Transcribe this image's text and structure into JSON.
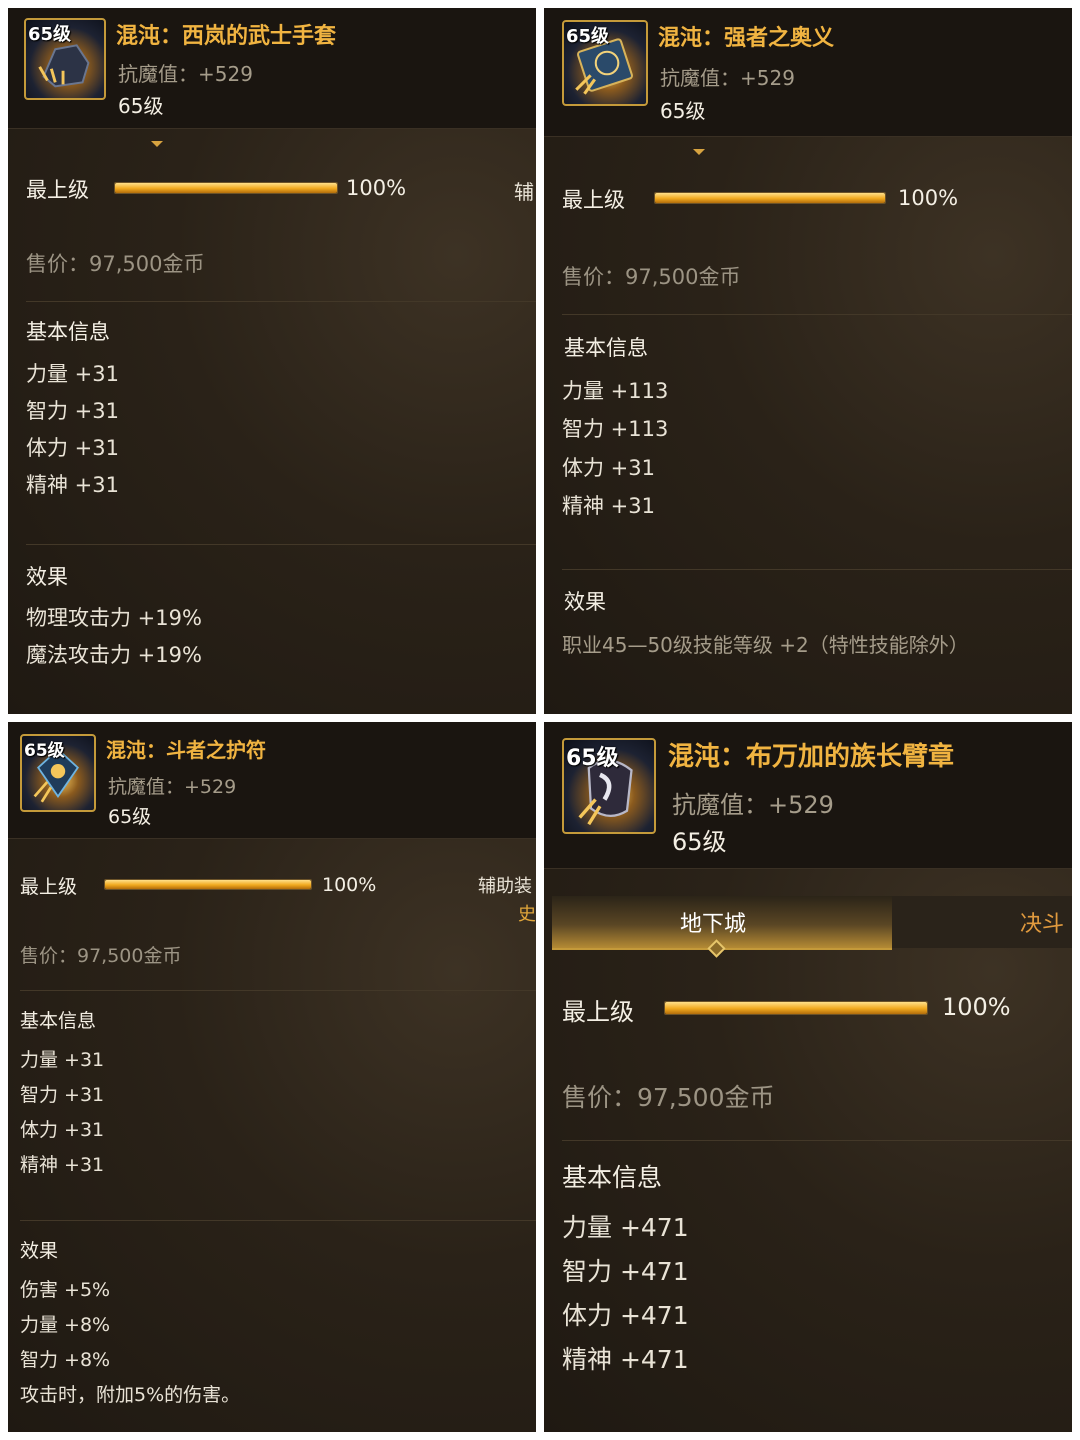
{
  "cards": [
    {
      "level_badge": "65级",
      "title": "混沌：西岚的武士手套",
      "resist": "抗魔值：+529",
      "level": "65级",
      "progress_label": "最上级",
      "progress_fraction": 1.0,
      "progress_text": "100%",
      "side_label": "辅",
      "price": "售价：97,500金币",
      "basic_header": "基本信息",
      "stats": [
        "力量 +31",
        "智力 +31",
        "体力 +31",
        "精神 +31"
      ],
      "effect_header": "效果",
      "effects": [
        "物理攻击力 +19%",
        "魔法攻击力 +19%"
      ]
    },
    {
      "level_badge": "65级",
      "title": "混沌：强者之奥义",
      "resist": "抗魔值：+529",
      "level": "65级",
      "progress_label": "最上级",
      "progress_fraction": 1.0,
      "progress_text": "100%",
      "price": "售价：97,500金币",
      "basic_header": "基本信息",
      "stats": [
        "力量 +113",
        "智力 +113",
        "体力 +31",
        "精神 +31"
      ],
      "effect_header": "效果",
      "effects": [
        "职业45—50级技能等级 +2（特性技能除外）"
      ]
    },
    {
      "level_badge": "65级",
      "title": "混沌：斗者之护符",
      "resist": "抗魔值：+529",
      "level": "65级",
      "progress_label": "最上级",
      "progress_fraction": 1.0,
      "progress_text": "100%",
      "side_label": "辅助装",
      "side_label_2": "史",
      "price": "售价：97,500金币",
      "basic_header": "基本信息",
      "stats": [
        "力量 +31",
        "智力 +31",
        "体力 +31",
        "精神 +31"
      ],
      "effect_header": "效果",
      "effects": [
        "伤害 +5%",
        "力量 +8%",
        "智力 +8%",
        "攻击时，附加5%的伤害。"
      ]
    },
    {
      "level_badge": "65级",
      "title": "混沌：布万加的族长臂章",
      "resist": "抗魔值：+529",
      "level": "65级",
      "tabs": [
        "地下城",
        "决斗"
      ],
      "progress_label": "最上级",
      "progress_fraction": 1.0,
      "progress_text": "100%",
      "price": "售价：97,500金币",
      "basic_header": "基本信息",
      "stats": [
        "力量 +471",
        "智力 +471",
        "体力 +471",
        "精神 +471"
      ]
    }
  ],
  "colors": {
    "panel_bg": "#2a2218",
    "header_bg": "#1a1510",
    "title_gold": "#f1b441",
    "bar_gold": "#f1a91e",
    "muted_text": "#a59c8a"
  },
  "icons": [
    "gauntlet-icon",
    "tome-icon",
    "amulet-icon",
    "armband-icon"
  ]
}
